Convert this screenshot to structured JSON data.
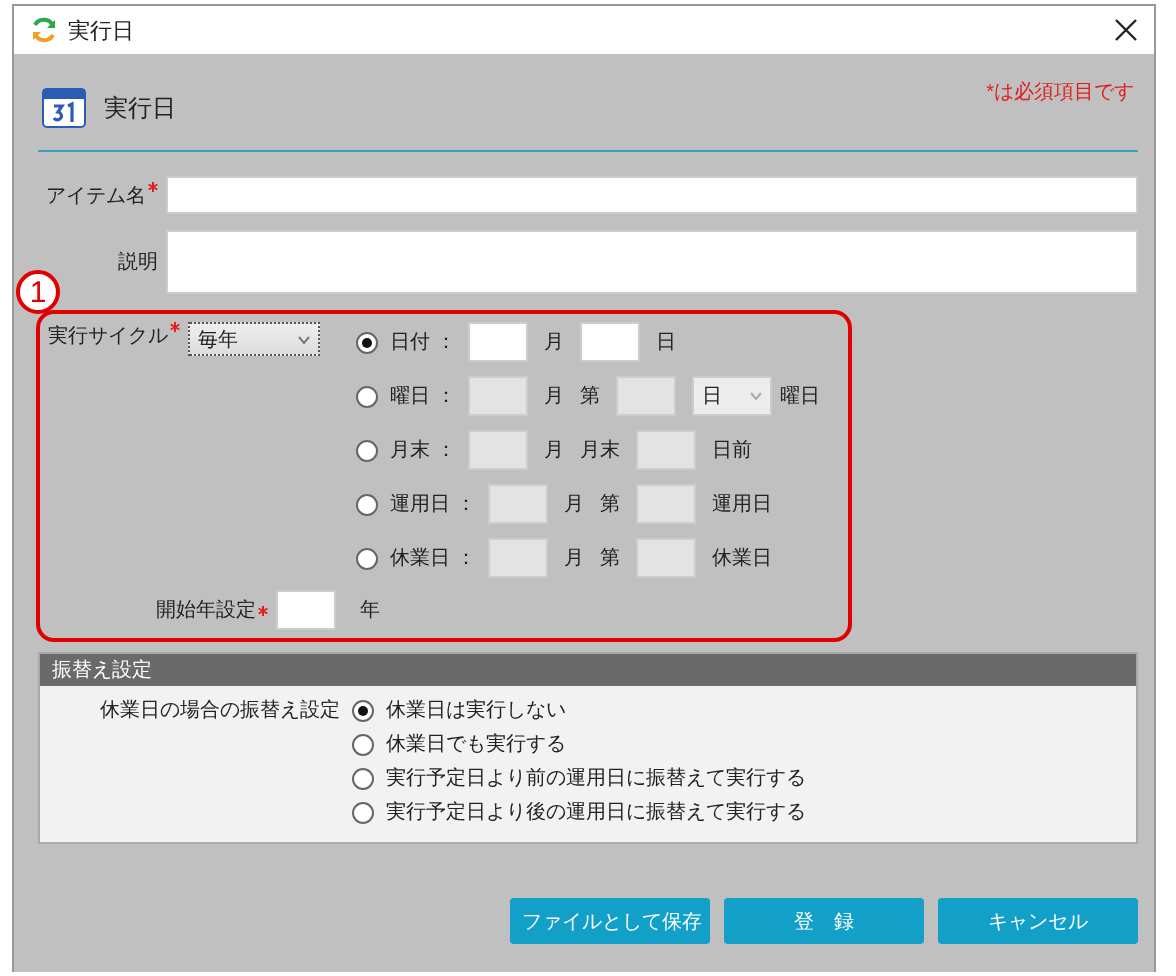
{
  "window": {
    "title": "実行日"
  },
  "header": {
    "title": "実行日",
    "required_note": "*は必須項目です"
  },
  "fields": [
    {
      "label": "アイテム名",
      "required": true,
      "kind": "line"
    },
    {
      "label": "説明",
      "required": false,
      "kind": "area"
    }
  ],
  "annotation": {
    "number": "1"
  },
  "cycle": {
    "label": "実行サイクル",
    "required": true,
    "value": "毎年"
  },
  "cycle_options": [
    {
      "label": "日付",
      "separator": "：",
      "selected": true,
      "parts": [
        {
          "kind": "field"
        },
        {
          "kind": "text",
          "text": "月"
        },
        {
          "kind": "field"
        },
        {
          "kind": "text",
          "text": "日"
        }
      ]
    },
    {
      "label": "曜日",
      "separator": "：",
      "selected": false,
      "parts": [
        {
          "kind": "field"
        },
        {
          "kind": "text",
          "text": "月"
        },
        {
          "kind": "text",
          "text": "第"
        },
        {
          "kind": "field"
        },
        {
          "kind": "dropdown",
          "text": "日"
        },
        {
          "kind": "text",
          "text": "曜日"
        }
      ]
    },
    {
      "label": "月末",
      "separator": "：",
      "selected": false,
      "parts": [
        {
          "kind": "field"
        },
        {
          "kind": "text",
          "text": "月"
        },
        {
          "kind": "text",
          "text": "月末"
        },
        {
          "kind": "field"
        },
        {
          "kind": "text",
          "text": "日前"
        }
      ]
    },
    {
      "label": "運用日",
      "separator": "：",
      "selected": false,
      "parts": [
        {
          "kind": "field"
        },
        {
          "kind": "text",
          "text": "月"
        },
        {
          "kind": "text",
          "text": "第"
        },
        {
          "kind": "field"
        },
        {
          "kind": "text",
          "text": "運用日"
        }
      ]
    },
    {
      "label": "休業日",
      "separator": "：",
      "selected": false,
      "parts": [
        {
          "kind": "field"
        },
        {
          "kind": "text",
          "text": "月"
        },
        {
          "kind": "text",
          "text": "第"
        },
        {
          "kind": "field"
        },
        {
          "kind": "text",
          "text": "休業日"
        }
      ]
    }
  ],
  "start_year": {
    "label": "開始年設定",
    "required": true,
    "unit": "年"
  },
  "substitution": {
    "title": "振替え設定",
    "label": "休業日の場合の振替え設定",
    "options": [
      {
        "label": "休業日は実行しない",
        "selected": true
      },
      {
        "label": "休業日でも実行する",
        "selected": false
      },
      {
        "label": "実行予定日より前の運用日に振替えて実行する",
        "selected": false
      },
      {
        "label": "実行予定日より後の運用日に振替えて実行する",
        "selected": false
      }
    ]
  },
  "buttons": [
    "ファイルとして保存",
    "登　録",
    "キャンセル"
  ]
}
